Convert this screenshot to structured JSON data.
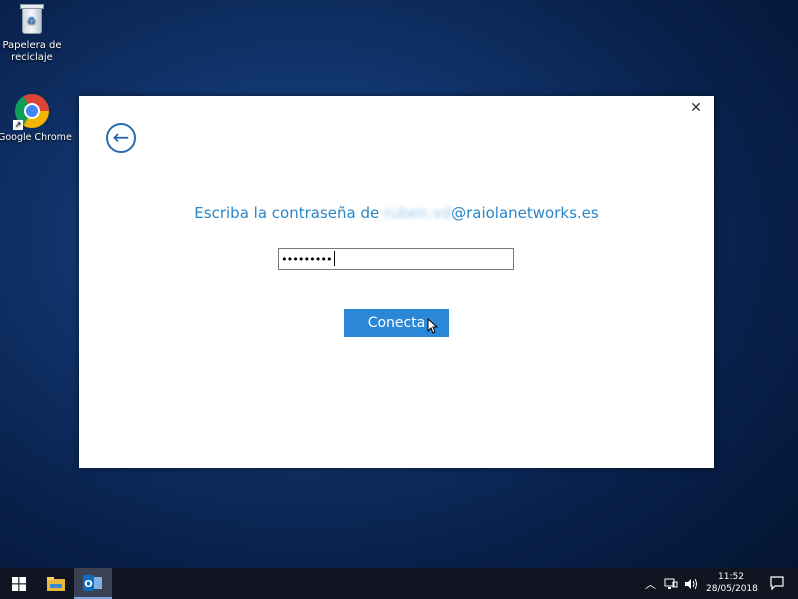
{
  "desktop": {
    "icons": [
      {
        "label": "Papelera de reciclaje"
      },
      {
        "label": "Google Chrome"
      }
    ]
  },
  "dialog": {
    "prompt_prefix": "Escriba la contraseña de ",
    "prompt_email_user": "ruben.vd",
    "prompt_email_domain": "@raiolanetworks.es",
    "password_value": "•••••••••",
    "connect_label": "Conecta",
    "close_glyph": "✕",
    "back_glyph": "←"
  },
  "taskbar": {
    "time": "11:52",
    "date": "28/05/2018"
  }
}
